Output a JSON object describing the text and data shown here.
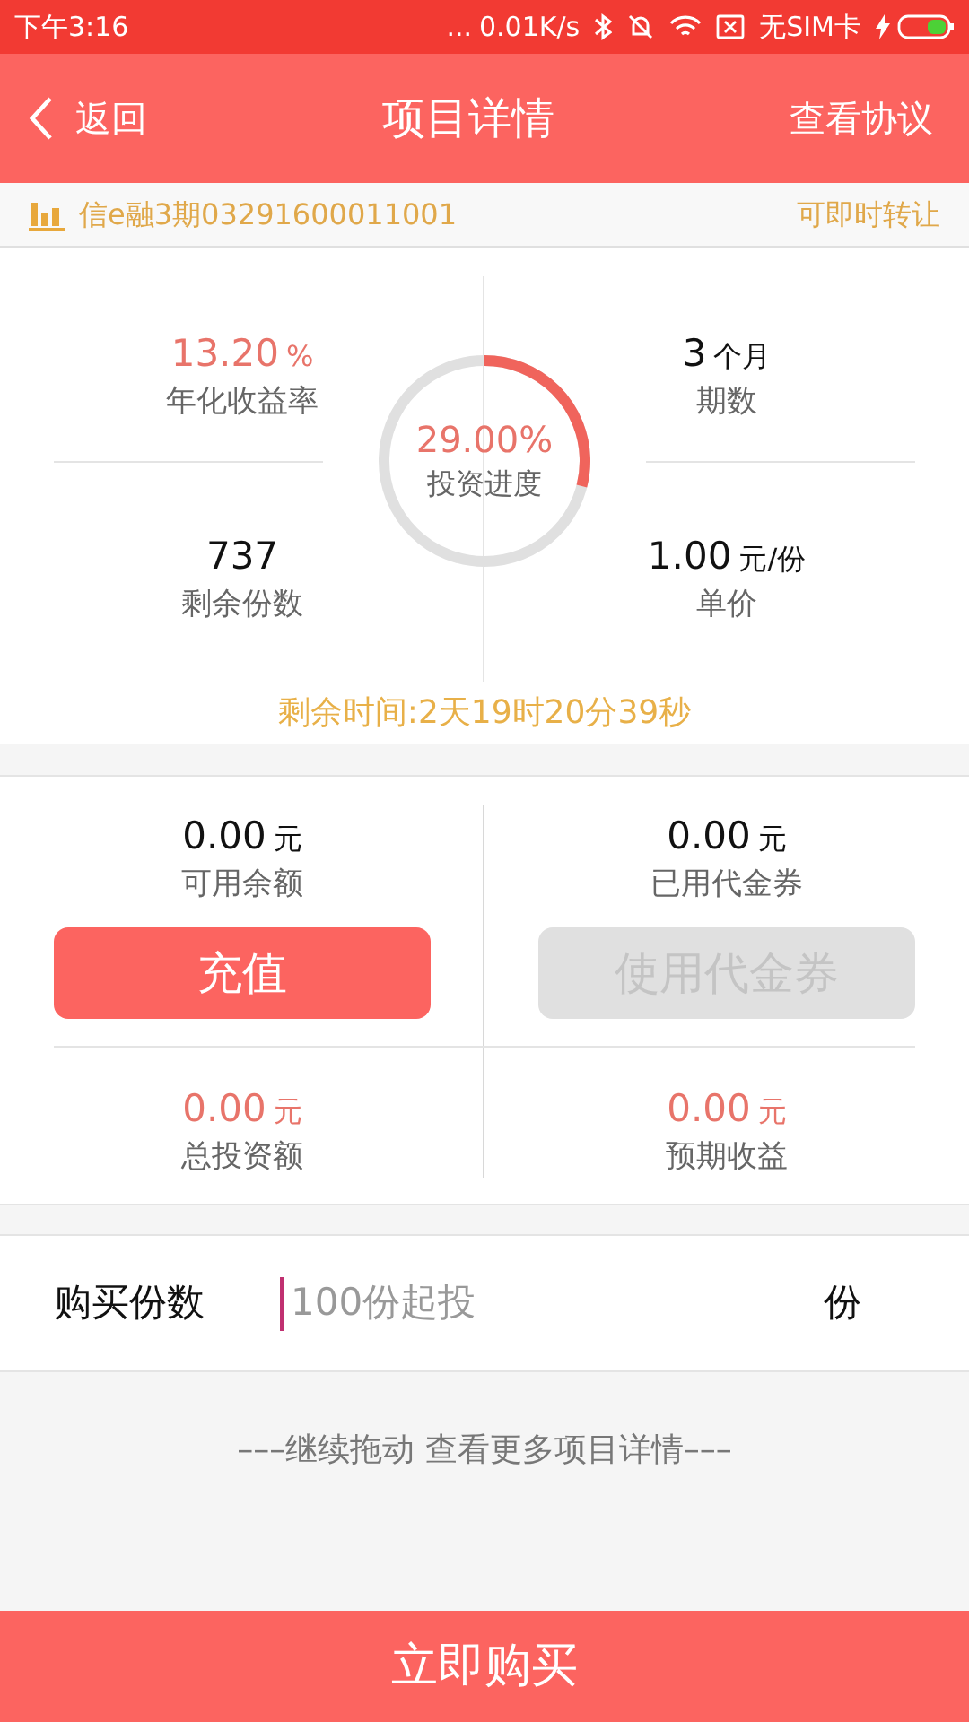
{
  "status_bar": {
    "time": "下午3:16",
    "dots": "...",
    "speed": "0.01K/s",
    "sim": "无SIM卡"
  },
  "nav": {
    "back": "返回",
    "title": "项目详情",
    "action": "查看协议"
  },
  "product": {
    "name": "信e融3期03291600011001",
    "tag": "可即时转让"
  },
  "stats": [
    {
      "value": "13.20",
      "unit": "%",
      "label": "年化收益率",
      "highlight": true
    },
    {
      "value": "3",
      "unit": "个月",
      "label": "期数",
      "highlight": false
    },
    {
      "value": "737",
      "label": "剩余份数",
      "highlight": false
    },
    {
      "value": "1.00",
      "unit": "元/份",
      "label": "单价",
      "highlight": false
    }
  ],
  "progress": {
    "value": "29.00%",
    "label": "投资进度",
    "level": 0.29
  },
  "countdown": "剩余时间:2天19时20分39秒",
  "account": [
    {
      "value": "0.00",
      "unit": "元",
      "label": "可用余额",
      "highlight": false
    },
    {
      "value": "0.00",
      "unit": "元",
      "label": "已用代金券",
      "highlight": false
    },
    {
      "value": "0.00",
      "unit": "元",
      "label": "总投资额",
      "highlight": true
    },
    {
      "value": "0.00",
      "unit": "元",
      "label": "预期收益",
      "highlight": true
    }
  ],
  "account_buttons": [
    {
      "label": "充值",
      "disabled": false
    },
    {
      "label": "使用代金券",
      "disabled": true
    }
  ],
  "purchase": {
    "label": "购买份数",
    "placeholder": "100份起投",
    "unit": "份"
  },
  "more_hint": "–––继续拖动 查看更多项目详情–––",
  "buy_button": "立即购买"
}
